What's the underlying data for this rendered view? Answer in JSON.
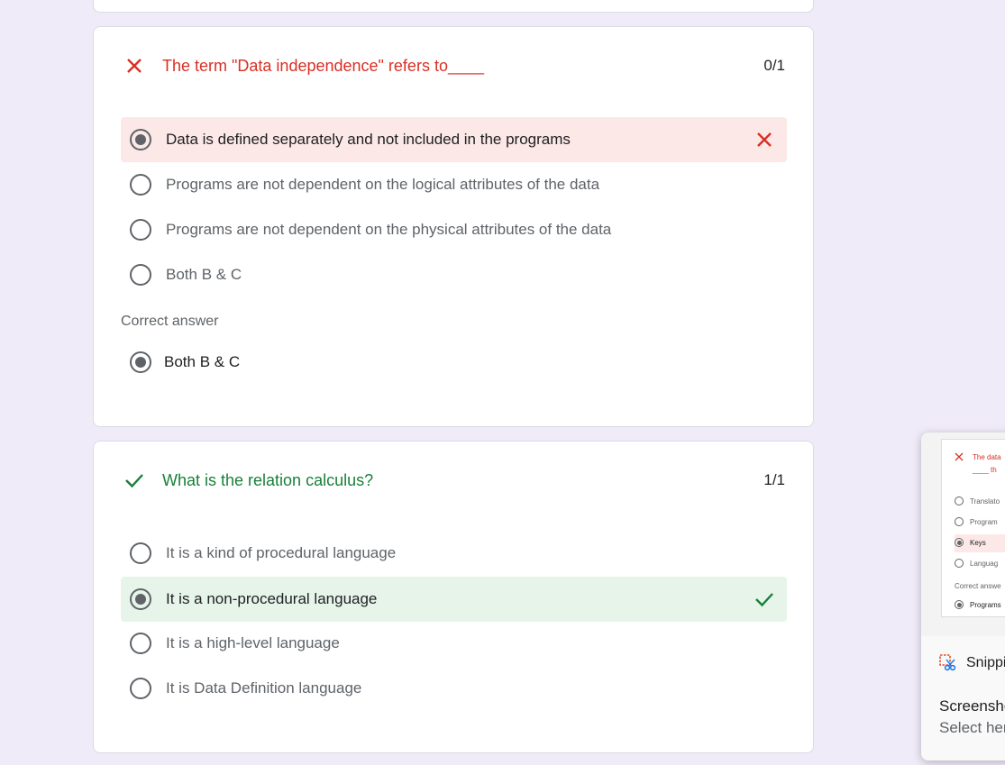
{
  "colors": {
    "page_bg": "#f0ebf8",
    "wrong": "#d93025",
    "right": "#188038",
    "wrong_bg": "#fce8e6",
    "right_bg": "#e6f4ea"
  },
  "questions": [
    {
      "status": "incorrect",
      "status_icon": "x-icon",
      "title": "The term \"Data independence\" refers to____",
      "score": "0/1",
      "options": [
        {
          "label": "Data is defined separately and not included in the programs",
          "selected": true,
          "mark": "x-icon"
        },
        {
          "label": "Programs are not dependent on the logical attributes of the data",
          "selected": false
        },
        {
          "label": "Programs are not dependent on the physical attributes of the data",
          "selected": false
        },
        {
          "label": "Both B & C",
          "selected": false
        }
      ],
      "correct_answer_label": "Correct answer",
      "correct_answer": "Both B & C"
    },
    {
      "status": "correct",
      "status_icon": "check-icon",
      "title": "What is the relation calculus?",
      "score": "1/1",
      "options": [
        {
          "label": "It is a kind of procedural language",
          "selected": false
        },
        {
          "label": "It is a non-procedural language",
          "selected": true,
          "mark": "check-icon"
        },
        {
          "label": "It is a high-level language",
          "selected": false
        },
        {
          "label": "It is Data Definition language",
          "selected": false
        }
      ]
    }
  ],
  "snipping_popup": {
    "thumbnail": {
      "title_line1": "The data",
      "title_line2": "____ th",
      "options": [
        "Translato",
        "Program",
        "Keys",
        "Languag"
      ],
      "correct_label": "Correct answe",
      "correct_value": "Programs"
    },
    "app_name": "Snippi",
    "title": "Screensho",
    "subtitle": "Select her"
  }
}
